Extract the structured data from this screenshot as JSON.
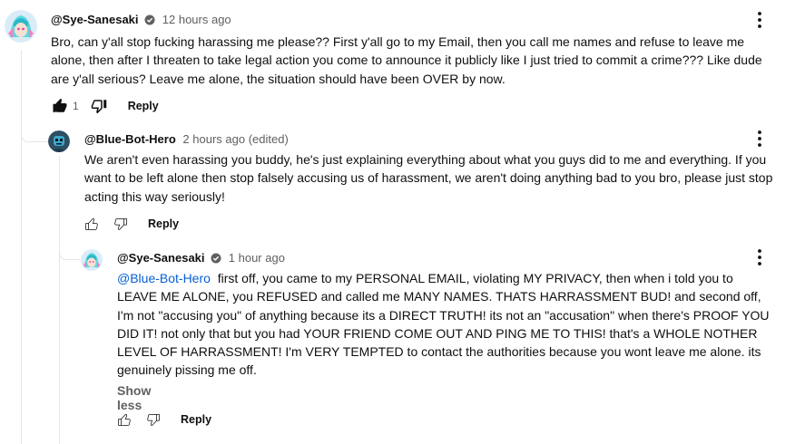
{
  "comments": [
    {
      "author": "@Sye-Sanesaki",
      "verified": true,
      "time": "12 hours ago",
      "edited": "",
      "text": "Bro, can y'all stop fucking harassing me please?? First y'all go to my Email, then you call me names and refuse to leave me alone, then after I threaten to take legal action you come to announce it publicly like I just tried to commit a crime??? Like dude are y'all serious? Leave me alone, the situation should have been OVER by now.",
      "like_count": "1",
      "reply_label": "Reply",
      "icons": [
        "more-vert-icon",
        "thumbs-up-icon",
        "thumbs-down-icon"
      ]
    },
    {
      "author": "@Blue-Bot-Hero",
      "verified": false,
      "time": "2 hours ago",
      "edited": "(edited)",
      "text": "We aren't even harassing you buddy, he's just explaining everything about what you guys did to me and everything. If you want to be left alone then stop falsely accusing us of harassment, we aren't doing anything bad to you bro, please just stop acting this way seriously!",
      "like_count": "",
      "reply_label": "Reply"
    },
    {
      "author": "@Sye-Sanesaki",
      "verified": true,
      "time": "1 hour ago",
      "edited": "",
      "mention": "@Blue-Bot-Hero",
      "text": "  first off, you came to my PERSONAL EMAIL, violating MY PRIVACY, then when i told you to LEAVE ME ALONE, you REFUSED and called me MANY NAMES. THATS HARRASSMENT BUD! and second off, I'm not \"accusing you\" of anything because its a DIRECT TRUTH! its not an \"accusation\" when there's PROOF YOU DID IT! not only that but you had YOUR FRIEND COME OUT AND PING ME TO THIS! that's a WHOLE NOTHER LEVEL OF HARRASSMENT! I'm VERY TEMPTED to contact the authorities because you wont leave me alone. its genuinely pissing me off.",
      "show_less": "Show less",
      "like_count": "",
      "reply_label": "Reply"
    }
  ],
  "colors": {
    "link": "#065fd4",
    "secondary_text": "#606060",
    "avatar_sye": "#d9ecf7",
    "avatar_bot": "#2d4e63"
  }
}
